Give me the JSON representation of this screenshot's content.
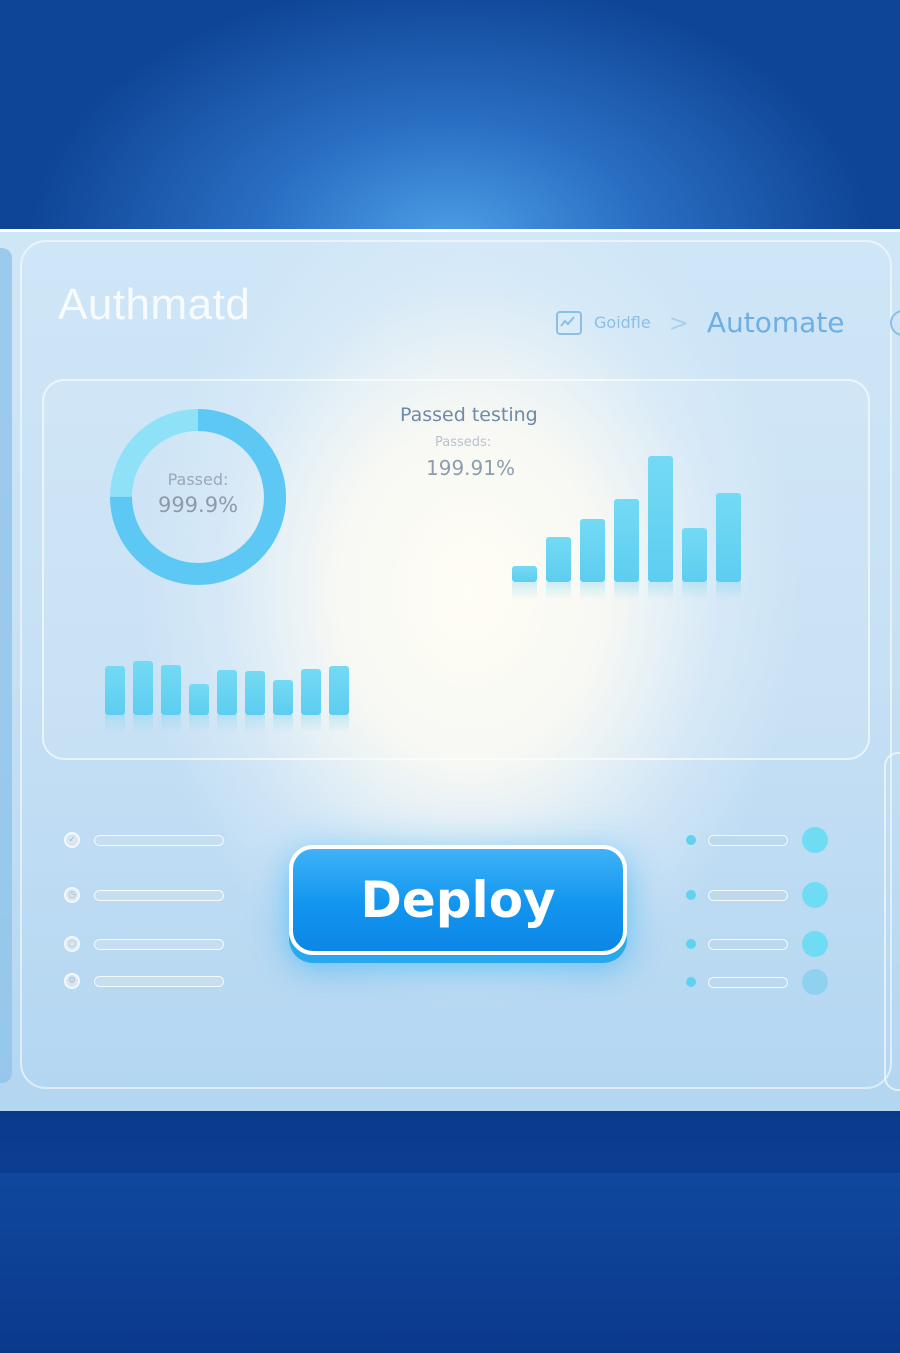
{
  "app": {
    "title": "Authmatd"
  },
  "breadcrumb": {
    "first": "Goidfle",
    "separator": ">",
    "current": "Automate"
  },
  "summary": {
    "donut_label": "Passed:",
    "donut_value": "999.9%",
    "donut_fraction": 0.75,
    "testing_title": "Passed testing",
    "testing_sub": "Passeds:",
    "testing_value": "199.91%"
  },
  "charts": {
    "right_bars": [
      0.13,
      0.36,
      0.5,
      0.66,
      1.0,
      0.43,
      0.71
    ],
    "left_bars": [
      0.9,
      1.0,
      0.93,
      0.57,
      0.83,
      0.81,
      0.64,
      0.86,
      0.9
    ]
  },
  "checklist_left": [
    {
      "icon": "check-icon",
      "glyph": "✓"
    },
    {
      "icon": "clock-icon",
      "glyph": "◷"
    },
    {
      "icon": "circle-icon",
      "glyph": "○"
    },
    {
      "icon": "gear-icon",
      "glyph": "⚙"
    }
  ],
  "checklist_right_count": 4,
  "actions": {
    "deploy_label": "Deploy"
  },
  "colors": {
    "accent": "#1195ef",
    "bar": "#5dcdf0",
    "donut": "#5ec8f4"
  }
}
